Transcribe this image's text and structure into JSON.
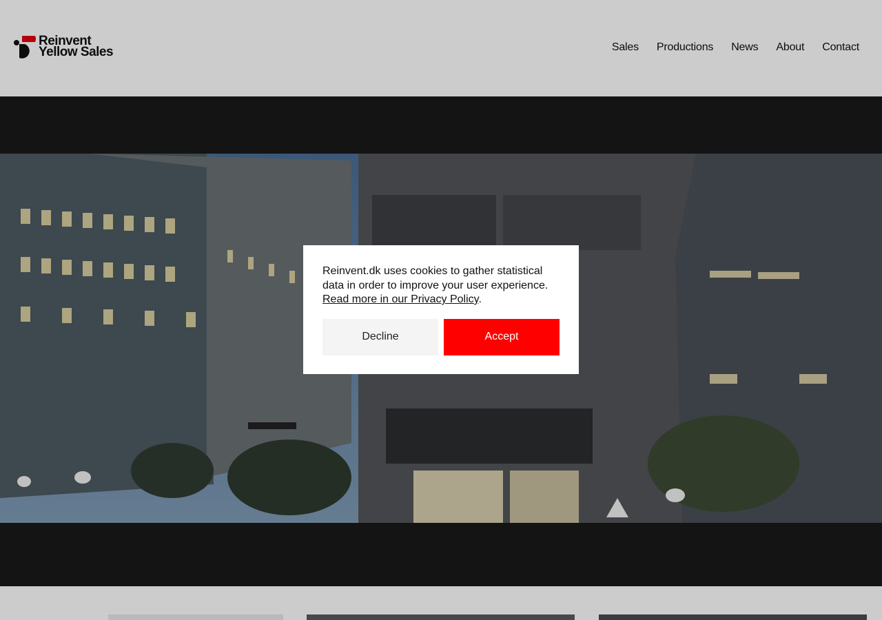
{
  "brand": {
    "line1": "Reinvent",
    "line2": "Yellow Sales",
    "accent_color": "#e3000f"
  },
  "nav": {
    "items": [
      {
        "label": "Sales"
      },
      {
        "label": "Productions"
      },
      {
        "label": "News"
      },
      {
        "label": "About"
      },
      {
        "label": "Contact"
      }
    ]
  },
  "hero": {
    "image_icon": "city-buildings-night-photo"
  },
  "cookie_banner": {
    "message": "Reinvent.dk uses cookies to gather statistical data in order to improve your user experience.",
    "link_text": "Read more in our Privacy Policy",
    "link_suffix": ".",
    "decline_label": "Decline",
    "accept_label": "Accept",
    "accept_color": "#ff0000"
  }
}
